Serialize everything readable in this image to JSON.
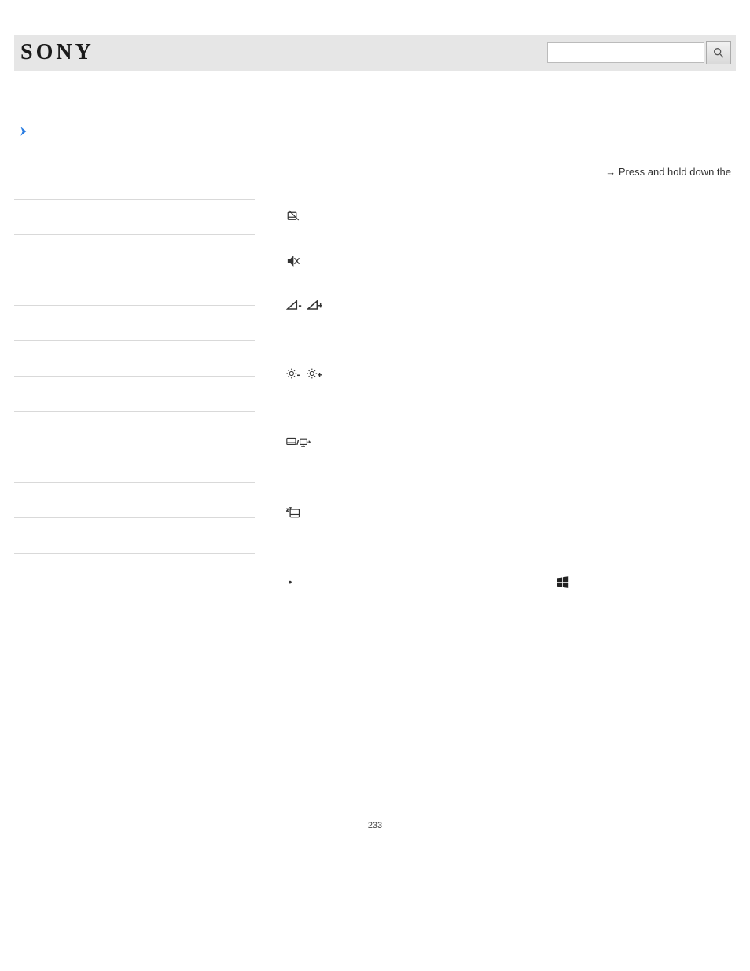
{
  "header": {
    "brand": "SONY",
    "search_placeholder": ""
  },
  "instruction_line": "Press and hold down the",
  "page_number": "233"
}
